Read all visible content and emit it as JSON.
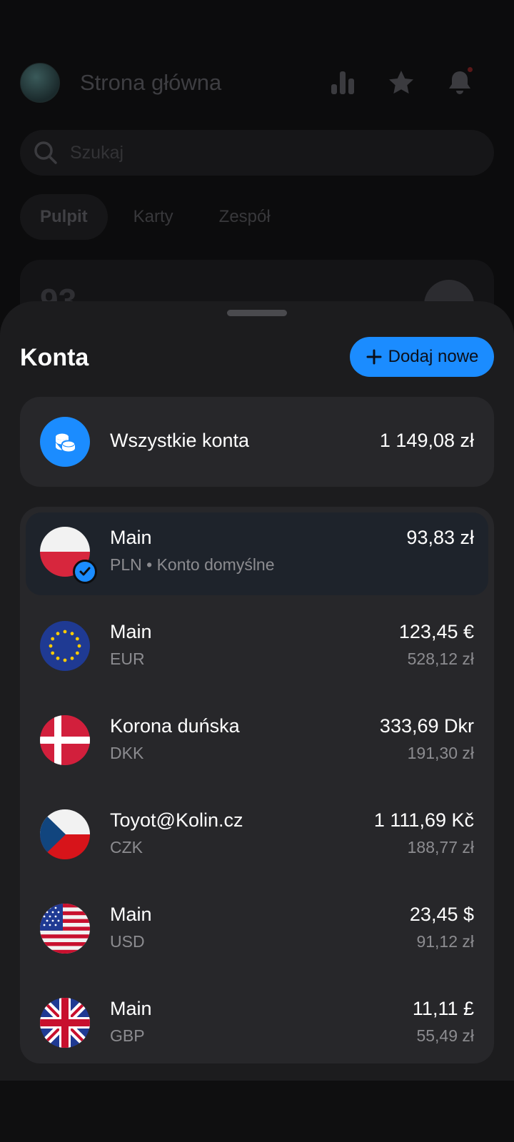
{
  "header": {
    "title": "Strona główna"
  },
  "search": {
    "placeholder": "Szukaj"
  },
  "tabs": [
    {
      "label": "Pulpit",
      "active": true
    },
    {
      "label": "Karty",
      "active": false
    },
    {
      "label": "Zespół",
      "active": false
    }
  ],
  "sheet": {
    "title": "Konta",
    "add_button_label": "Dodaj nowe",
    "all_accounts": {
      "label": "Wszystkie konta",
      "amount": "1 149,08 zł"
    },
    "accounts": [
      {
        "name": "Main",
        "subtitle": "PLN • Konto domyślne",
        "amount": "93,83 zł",
        "converted": "",
        "flag": "pl-flag-icon",
        "selected": true
      },
      {
        "name": "Main",
        "subtitle": "EUR",
        "amount": "123,45 €",
        "converted": "528,12 zł",
        "flag": "eu-flag-icon",
        "selected": false
      },
      {
        "name": "Korona duńska",
        "subtitle": "DKK",
        "amount": "333,69 Dkr",
        "converted": "191,30 zł",
        "flag": "dk-flag-icon",
        "selected": false
      },
      {
        "name": "Toyot@Kolin.cz",
        "subtitle": "CZK",
        "amount": "1 111,69 Kč",
        "converted": "188,77 zł",
        "flag": "cz-flag-icon",
        "selected": false
      },
      {
        "name": "Main",
        "subtitle": "USD",
        "amount": "23,45 $",
        "converted": "91,12 zł",
        "flag": "us-flag-icon",
        "selected": false
      },
      {
        "name": "Main",
        "subtitle": "GBP",
        "amount": "11,11 £",
        "converted": "55,49 zł",
        "flag": "gb-flag-icon",
        "selected": false
      }
    ]
  },
  "colors": {
    "accent": "#1b8cff",
    "sheet_bg": "#1c1c1e",
    "card_bg": "#27272a",
    "selected_bg": "#1e232b"
  }
}
